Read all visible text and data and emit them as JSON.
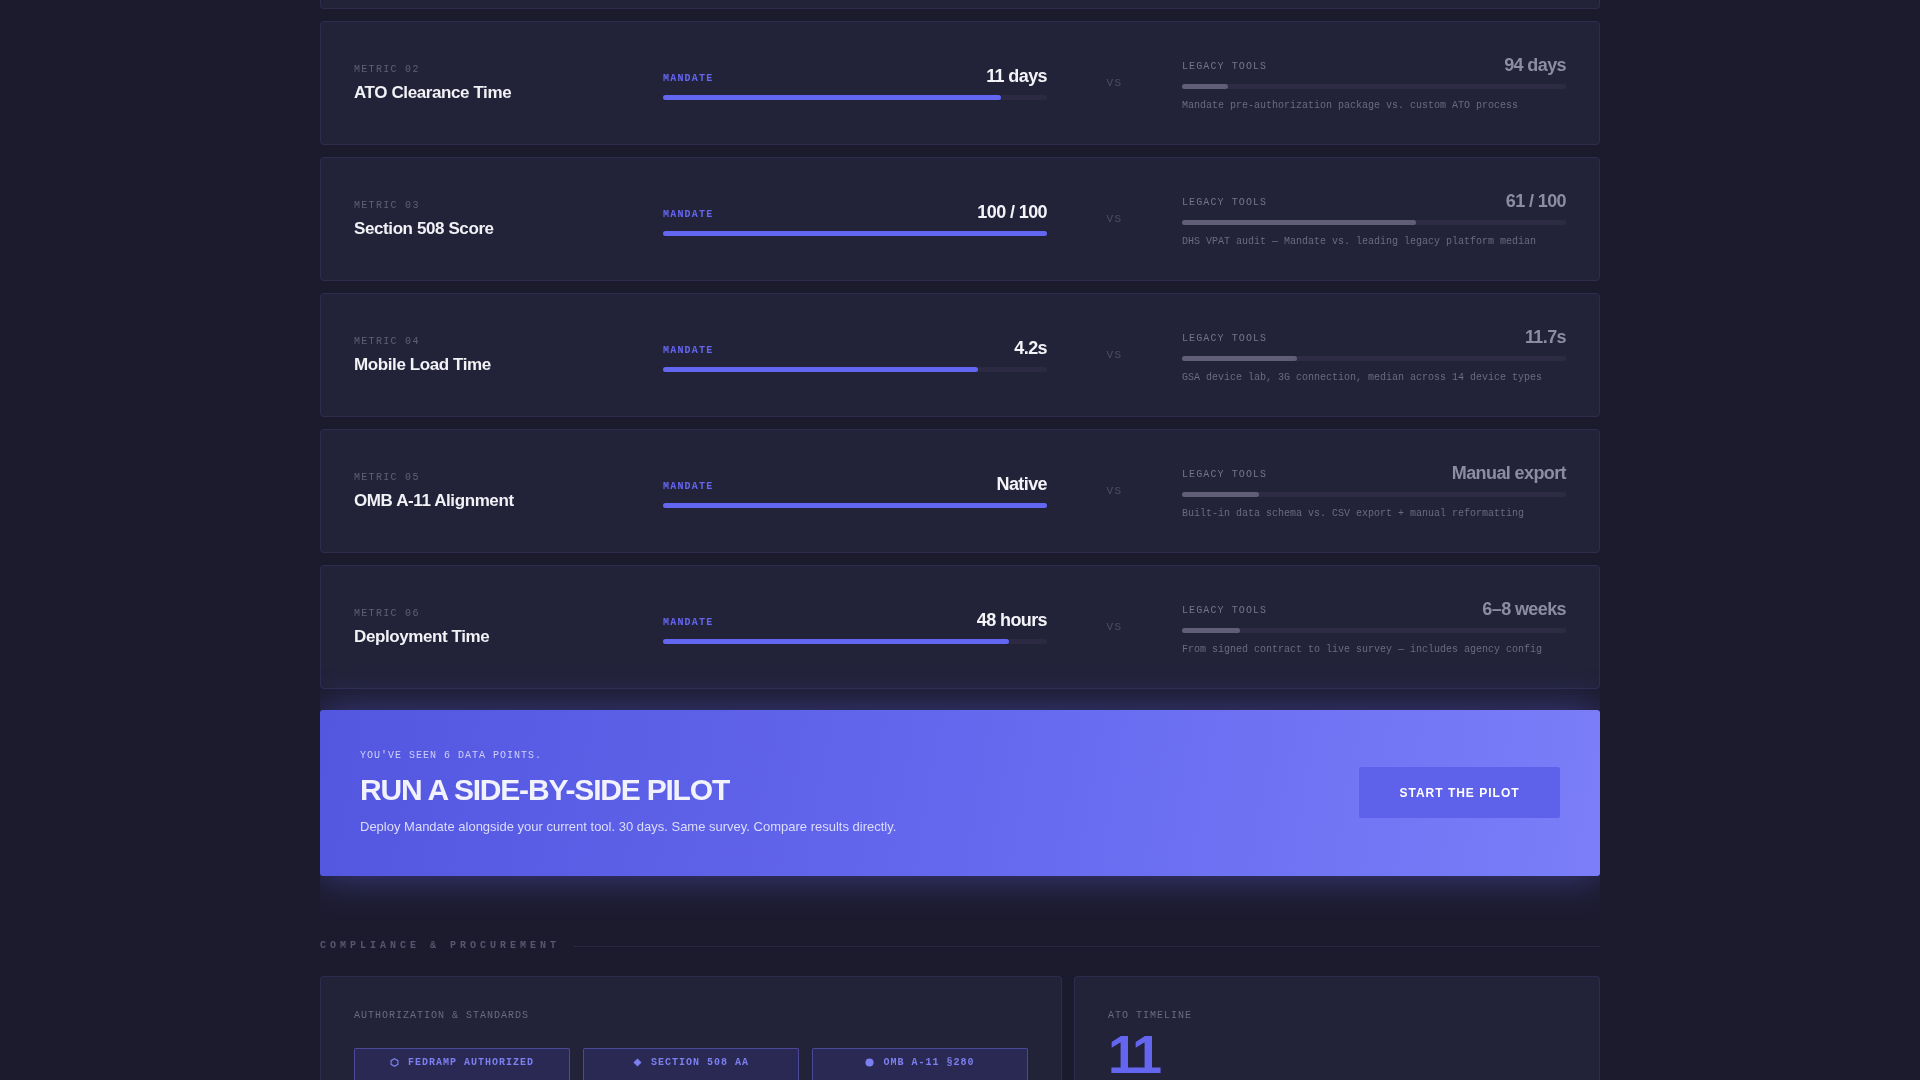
{
  "metrics": [
    {
      "label": "METRIC 02",
      "title": "ATO Clearance Time",
      "mandate": {
        "label": "MANDATE",
        "value": "11 days",
        "level": 0.88
      },
      "vs": "VS",
      "legacy": {
        "label": "LEGACY TOOLS",
        "value": "94 days",
        "level": 0.12,
        "note": "Mandate pre-authorization package vs. custom ATO process"
      }
    },
    {
      "label": "METRIC 03",
      "title": "Section 508 Score",
      "mandate": {
        "label": "MANDATE",
        "value": "100 / 100",
        "level": 1
      },
      "vs": "VS",
      "legacy": {
        "label": "LEGACY TOOLS",
        "value": "61 / 100",
        "level": 0.61,
        "note": "DHS VPAT audit — Mandate vs. leading legacy platform median"
      }
    },
    {
      "label": "METRIC 04",
      "title": "Mobile Load Time",
      "mandate": {
        "label": "MANDATE",
        "value": "4.2s",
        "level": 0.82
      },
      "vs": "VS",
      "legacy": {
        "label": "LEGACY TOOLS",
        "value": "11.7s",
        "level": 0.3,
        "note": "GSA device lab, 3G connection, median across 14 device types"
      }
    },
    {
      "label": "METRIC 05",
      "title": "OMB A-11 Alignment",
      "mandate": {
        "label": "MANDATE",
        "value": "Native",
        "level": 1
      },
      "vs": "VS",
      "legacy": {
        "label": "LEGACY TOOLS",
        "value": "Manual export",
        "level": 0.2,
        "note": "Built-in data schema vs. CSV export + manual reformatting"
      }
    },
    {
      "label": "METRIC 06",
      "title": "Deployment Time",
      "mandate": {
        "label": "MANDATE",
        "value": "48 hours",
        "level": 0.9
      },
      "vs": "VS",
      "legacy": {
        "label": "LEGACY TOOLS",
        "value": "6–8 weeks",
        "level": 0.15,
        "note": "From signed contract to live survey — includes agency config"
      }
    }
  ],
  "cta": {
    "eyebrow": "YOU'VE SEEN 6 DATA POINTS.",
    "title": "RUN A SIDE-BY-SIDE PILOT",
    "text": "Deploy Mandate alongside your current tool. 30 days. Same survey. Compare results directly.",
    "button": "START THE PILOT"
  },
  "compliance": {
    "heading": "COMPLIANCE & PROCUREMENT",
    "standards": {
      "title": "AUTHORIZATION & STANDARDS",
      "badges": [
        {
          "kind": "hexagon",
          "label": "FEDRAMP AUTHORIZED"
        },
        {
          "kind": "diamond",
          "label": "SECTION 508 AA"
        },
        {
          "kind": "dot",
          "label": "OMB A-11 §280"
        }
      ]
    },
    "ato": {
      "title": "ATO TIMELINE",
      "value": "11"
    }
  }
}
